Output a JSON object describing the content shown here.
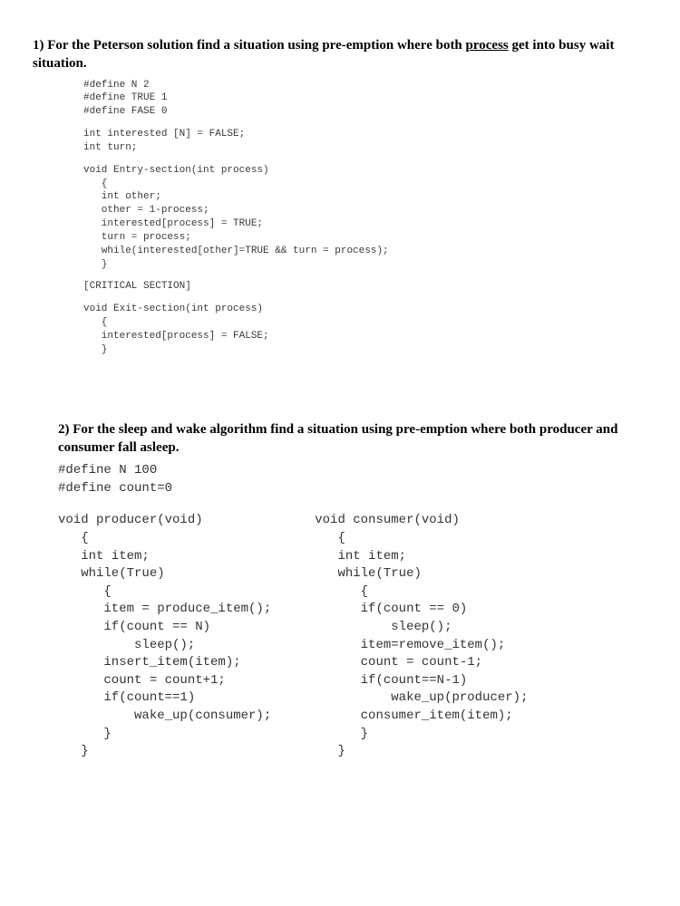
{
  "q1": {
    "number": "1)",
    "text_a": "For the Peterson solution find a situation using pre-emption where both ",
    "text_underlined": "process",
    "text_b": " get into busy wait situation.",
    "code_block1": "#define N 2\n#define TRUE 1\n#define FASE 0",
    "code_block2": "int interested [N] = FALSE;\nint turn;",
    "code_block3": "void Entry-section(int process)\n   {\n   int other;\n   other = 1-process;\n   interested[process] = TRUE;\n   turn = process;\n   while(interested[other]=TRUE && turn = process);\n   }",
    "code_block4": "[CRITICAL SECTION]",
    "code_block5": "void Exit-section(int process)\n   {\n   interested[process] = FALSE;\n   }"
  },
  "q2": {
    "number": "2)",
    "text": "For the sleep and wake algorithm find a situation using pre-emption where both producer and consumer fall asleep.",
    "defines": "#define N 100\n#define count=0",
    "producer": "void producer(void)\n   {\n   int item;\n   while(True)\n      {\n      item = produce_item();\n      if(count == N)\n          sleep();\n      insert_item(item);\n      count = count+1;\n      if(count==1)\n          wake_up(consumer);\n      }\n   }",
    "consumer": "void consumer(void)\n   {\n   int item;\n   while(True)\n      {\n      if(count == 0)\n          sleep();\n      item=remove_item();\n      count = count-1;\n      if(count==N-1)\n          wake_up(producer);\n      consumer_item(item);\n      }\n   }"
  }
}
